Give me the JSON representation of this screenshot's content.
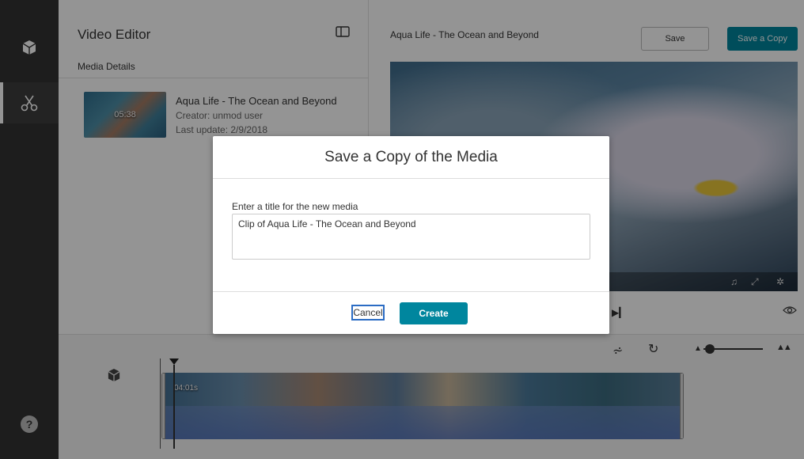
{
  "rail": {
    "items": [
      {
        "icon": "cube-icon"
      },
      {
        "icon": "scissors-icon",
        "active": true
      }
    ],
    "help_label": "?"
  },
  "editor": {
    "title": "Video Editor",
    "section_label": "Media Details"
  },
  "media": {
    "thumbnail_duration": "05:38",
    "title": "Aqua Life - The Ocean and Beyond",
    "creator": "Creator: unmod user",
    "last_update": "Last update: 2/9/2018"
  },
  "player": {
    "title": "Aqua Life - The Ocean and Beyond",
    "save_label": "Save",
    "save_copy_label": "Save a Copy"
  },
  "timeline": {
    "clip_time": "04:01s",
    "zoom_level": 0.1
  },
  "dialog": {
    "title": "Save a Copy of the Media",
    "field_label": "Enter a title for the new media",
    "field_value": "Clip of Aqua Life - The Ocean and Beyond",
    "cancel_label": "Cancel",
    "create_label": "Create"
  },
  "colors": {
    "accent": "#00869e",
    "rail_bg": "#333333"
  }
}
